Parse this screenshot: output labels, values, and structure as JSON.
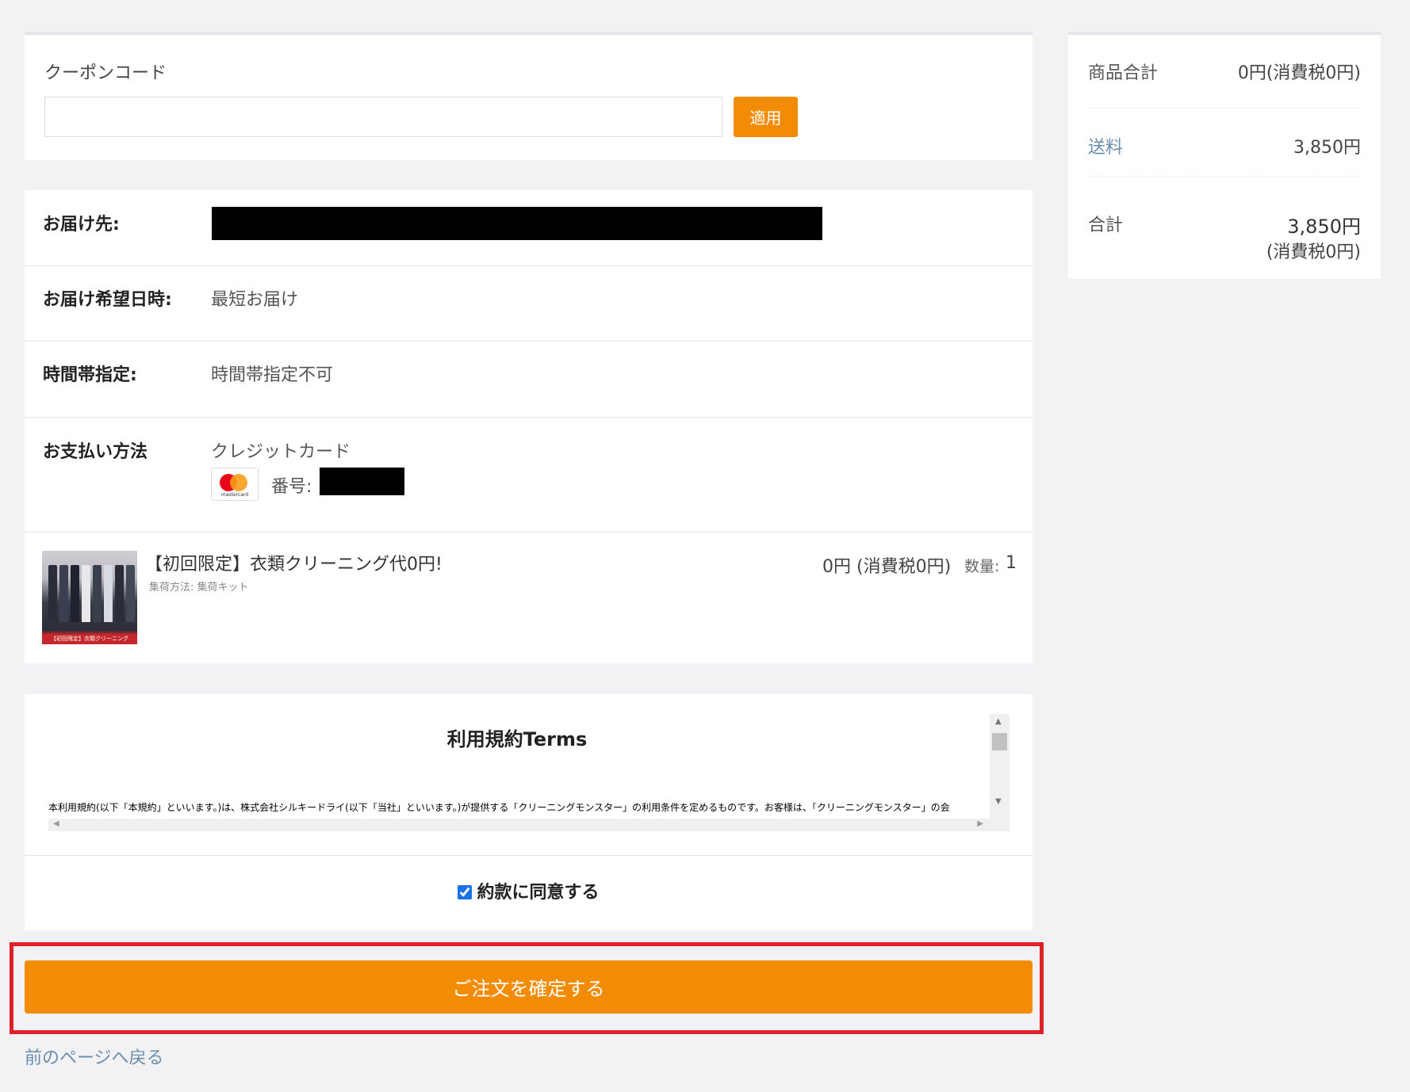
{
  "coupon": {
    "label": "クーポンコード",
    "input_value": "",
    "placeholder": "",
    "apply_label": "適用"
  },
  "details": {
    "delivery_label": "お届け先:",
    "delivery_datetime_label": "お届け希望日時:",
    "delivery_datetime_value": "最短お届け",
    "time_slot_label": "時間帯指定:",
    "time_slot_value": "時間帯指定不可",
    "payment_label": "お支払い方法",
    "payment_value": "クレジットカード",
    "card_brand": "mastercard",
    "card_number_label": "番号:",
    "card_icon": "mastercard-icon"
  },
  "product": {
    "title": "【初回限定】衣類クリーニング代0円!",
    "sub": "集荷方法: 集荷キット",
    "price": "0円 (消費税0円)",
    "qty_label": "数量:",
    "qty": "1",
    "image_caption": "【初回限定】衣類クリーニング"
  },
  "terms": {
    "title": "利用規約Terms",
    "text": "本利用規約(以下「本規約」といいます。)は、株式会社シルキードライ(以下「当社」といいます。)が提供する「クリーニングモンスター」の利用条件を定めるものです。お客様は、「クリーニングモンスター」の会",
    "agree_label": "約款に同意する",
    "agree_checked": true
  },
  "actions": {
    "confirm_label": "ご注文を確定する",
    "back_label": "前のページへ戻る"
  },
  "summary": {
    "subtotal_label": "商品合計",
    "subtotal_value": "0円(消費税0円)",
    "shipping_label": "送料",
    "shipping_value": "3,850円",
    "total_label": "合計",
    "total_value": "3,850円",
    "total_tax": "(消費税0円)"
  },
  "colors": {
    "accent": "#f38c05",
    "highlight": "#e0212a",
    "link": "#6a8db0",
    "background": "#f2f2f4"
  }
}
